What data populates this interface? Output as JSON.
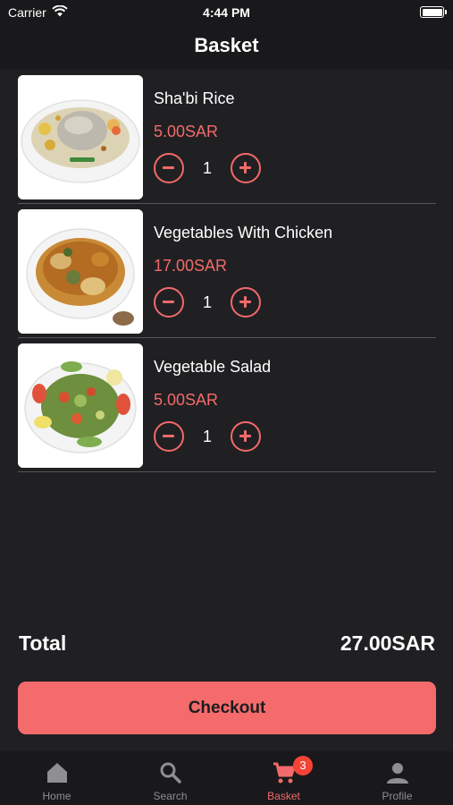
{
  "status_bar": {
    "carrier": "Carrier",
    "time": "4:44 PM"
  },
  "header": {
    "title": "Basket"
  },
  "basket": {
    "items": [
      {
        "name": "Sha'bi Rice",
        "price": "5.00SAR",
        "quantity": "1"
      },
      {
        "name": "Vegetables With Chicken",
        "price": "17.00SAR",
        "quantity": "1"
      },
      {
        "name": "Vegetable Salad",
        "price": "5.00SAR",
        "quantity": "1"
      }
    ],
    "total_label": "Total",
    "total_value": "27.00SAR",
    "checkout_label": "Checkout"
  },
  "tabs": [
    {
      "label": "Home",
      "icon": "home-icon"
    },
    {
      "label": "Search",
      "icon": "search-icon"
    },
    {
      "label": "Basket",
      "icon": "cart-icon",
      "badge": "3",
      "active": true
    },
    {
      "label": "Profile",
      "icon": "person-icon"
    }
  ],
  "colors": {
    "accent": "#f26a6a",
    "background": "#202023",
    "bar": "#19191b",
    "badge": "#f44336"
  }
}
